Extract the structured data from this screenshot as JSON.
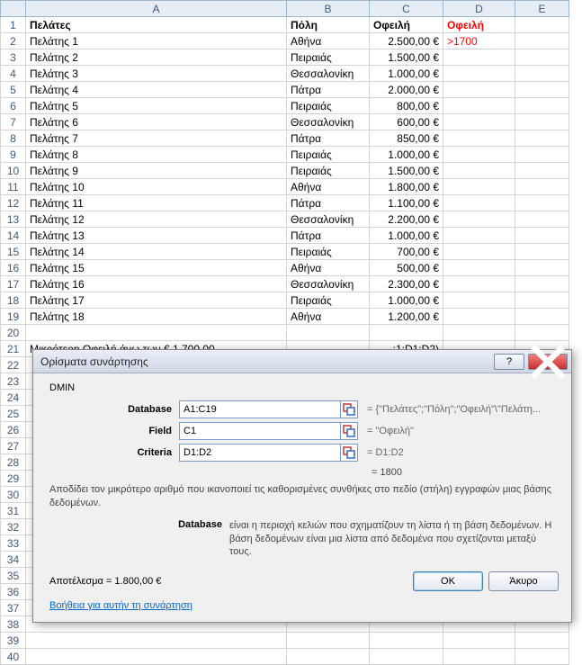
{
  "columns": [
    "A",
    "B",
    "C",
    "D",
    "E"
  ],
  "headers": {
    "A": "Πελάτες",
    "B": "Πόλη",
    "C": "Οφειλή",
    "D": "Οφειλή"
  },
  "criteria_value": ">1700",
  "rows": [
    {
      "a": "Πελάτης 1",
      "b": "Αθήνα",
      "c": "2.500,00 €"
    },
    {
      "a": "Πελάτης 2",
      "b": "Πειραιάς",
      "c": "1.500,00 €"
    },
    {
      "a": "Πελάτης 3",
      "b": "Θεσσαλονίκη",
      "c": "1.000,00 €"
    },
    {
      "a": "Πελάτης 4",
      "b": "Πάτρα",
      "c": "2.000,00 €"
    },
    {
      "a": "Πελάτης 5",
      "b": "Πειραιάς",
      "c": "800,00 €"
    },
    {
      "a": "Πελάτης 6",
      "b": "Θεσσαλονίκη",
      "c": "600,00 €"
    },
    {
      "a": "Πελάτης 7",
      "b": "Πάτρα",
      "c": "850,00 €"
    },
    {
      "a": "Πελάτης 8",
      "b": "Πειραιάς",
      "c": "1.000,00 €"
    },
    {
      "a": "Πελάτης 9",
      "b": "Πειραιάς",
      "c": "1.500,00 €"
    },
    {
      "a": "Πελάτης 10",
      "b": "Αθήνα",
      "c": "1.800,00 €"
    },
    {
      "a": "Πελάτης 11",
      "b": "Πάτρα",
      "c": "1.100,00 €"
    },
    {
      "a": "Πελάτης 12",
      "b": "Θεσσαλονίκη",
      "c": "2.200,00 €"
    },
    {
      "a": "Πελάτης 13",
      "b": "Πάτρα",
      "c": "1.000,00 €"
    },
    {
      "a": "Πελάτης 14",
      "b": "Πειραιάς",
      "c": "700,00 €"
    },
    {
      "a": "Πελάτης 15",
      "b": "Αθήνα",
      "c": "500,00 €"
    },
    {
      "a": "Πελάτης 16",
      "b": "Θεσσαλονίκη",
      "c": "2.300,00 €"
    },
    {
      "a": "Πελάτης 17",
      "b": "Πειραιάς",
      "c": "1.000,00 €"
    },
    {
      "a": "Πελάτης 18",
      "b": "Αθήνα",
      "c": "1.200,00 €"
    }
  ],
  "row21_label": "Μικρότερη Οφειλή άνω των € 1.700,00",
  "row21_formula": ":1;D1:D2)",
  "dialog": {
    "title": "Ορίσματα συνάρτησης",
    "func_name": "DMIN",
    "args": {
      "database": {
        "label": "Database",
        "value": "A1:C19",
        "result": "= {\"Πελάτες\";\"Πόλη\";\"Οφειλή\"\\\"Πελάτη..."
      },
      "field": {
        "label": "Field",
        "value": "C1",
        "result": "= \"Οφειλή\""
      },
      "criteria": {
        "label": "Criteria",
        "value": "D1:D2",
        "result": "= D1:D2"
      }
    },
    "calc_result": "= 1800",
    "description": "Αποδίδει τον μικρότερο αριθμό που ικανοποιεί τις καθορισμένες συνθήκες στο πεδίο (στήλη) εγγραφών μιας βάσης δεδομένων.",
    "arg_desc_label": "Database",
    "arg_desc_text": "είναι η περιοχή κελιών που σχηματίζουν τη λίστα ή τη βάση δεδομένων. Η βάση δεδομένων είναι μια λίστα από δεδομένα που σχετίζονται μεταξύ τους.",
    "result_label": "Αποτέλεσμα = 1.800,00 €",
    "help_link": "Βοήθεια για αυτήν τη συνάρτηση",
    "ok": "OK",
    "cancel": "Άκυρο"
  }
}
